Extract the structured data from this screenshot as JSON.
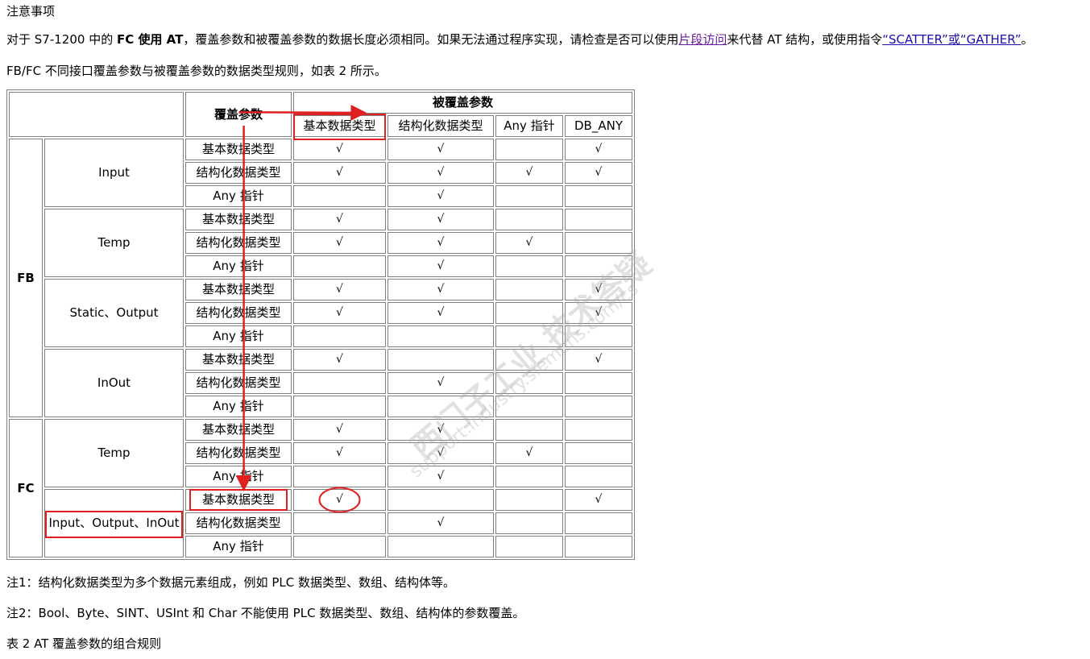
{
  "heading": "注意事项",
  "p1": {
    "pre": "对于 S7-1200 中的 ",
    "bold": "FC 使用 AT",
    "mid": "，覆盖参数和被覆盖参数的数据长度必须相同。如果无法通过程序实现，请检查是否可以使用",
    "link1": "片段访问",
    "mid2": "来代替 AT 结构，或使用指令",
    "link2": "“SCATTER”或“GATHER”",
    "end": "。"
  },
  "p2": "FB/FC 不同接口覆盖参数与被覆盖参数的数据类型规则，如表 2 所示。",
  "table": {
    "override_header": "覆盖参数",
    "overridden_header": "被覆盖参数",
    "columns": [
      "基本数据类型",
      "结构化数据类型",
      "Any 指针",
      "DB_ANY"
    ],
    "row_types": [
      "基本数据类型",
      "结构化数据类型",
      "Any 指针"
    ],
    "groups": [
      {
        "name": "FB",
        "sections": [
          {
            "name": "Input",
            "rows": [
              [
                "√",
                "√",
                "",
                "√"
              ],
              [
                "√",
                "√",
                "√",
                "√"
              ],
              [
                "",
                "√",
                "",
                ""
              ]
            ]
          },
          {
            "name": "Temp",
            "rows": [
              [
                "√",
                "√",
                "",
                ""
              ],
              [
                "√",
                "√",
                "√",
                ""
              ],
              [
                "",
                "√",
                "",
                ""
              ]
            ]
          },
          {
            "name": "Static、Output",
            "rows": [
              [
                "√",
                "√",
                "",
                "√"
              ],
              [
                "√",
                "√",
                "",
                "√"
              ],
              [
                "",
                "",
                "",
                ""
              ]
            ]
          },
          {
            "name": "InOut",
            "rows": [
              [
                "√",
                "",
                "",
                "√"
              ],
              [
                "",
                "√",
                "",
                ""
              ],
              [
                "",
                "",
                "",
                ""
              ]
            ]
          }
        ]
      },
      {
        "name": "FC",
        "sections": [
          {
            "name": "Temp",
            "rows": [
              [
                "√",
                "√",
                "",
                ""
              ],
              [
                "√",
                "√",
                "√",
                ""
              ],
              [
                "",
                "√",
                "",
                ""
              ]
            ]
          },
          {
            "name": "Input、Output、InOut",
            "rows": [
              [
                "√",
                "",
                "",
                "√"
              ],
              [
                "",
                "√",
                "",
                ""
              ],
              [
                "",
                "",
                "",
                ""
              ]
            ]
          }
        ]
      }
    ]
  },
  "note1": "注1：结构化数据类型为多个数据元素组成，例如 PLC 数据类型、数组、结构体等。",
  "note2": "注2：Bool、Byte、SINT、USInt 和 Char 不能使用 PLC 数据类型、数组、结构体的参数覆盖。",
  "caption": "表 2 AT 覆盖参数的组合规则",
  "watermark": {
    "line1": "西门子工业 技术答疑",
    "line2": "support.industry.siemens.com/cs"
  },
  "colors": {
    "annotation": "#e02020",
    "link": "#1a0dab",
    "visited_link": "#6a1b9a",
    "border": "#808080"
  }
}
